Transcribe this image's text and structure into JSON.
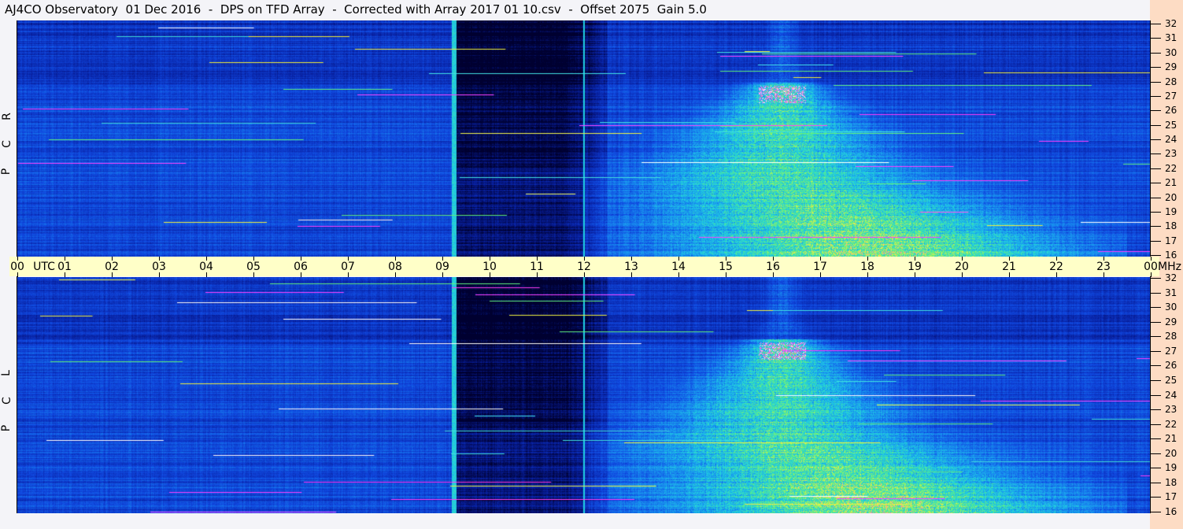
{
  "title": "AJ4CO Observatory  01 Dec 2016  -  DPS on TFD Array  -  Corrected with Array 2017 01 10.csv  -  Offset 2075  Gain 5.0",
  "chart_data": {
    "type": "heatmap",
    "panels": [
      {
        "label_letters": [
          "R",
          "C",
          "P"
        ]
      },
      {
        "label_letters": [
          "L",
          "C",
          "P"
        ]
      }
    ],
    "x_axis": {
      "unit_label": "UTC",
      "range_hours": [
        0,
        24
      ],
      "tick_labels": [
        "00",
        "01",
        "02",
        "03",
        "04",
        "05",
        "06",
        "07",
        "08",
        "09",
        "10",
        "11",
        "12",
        "13",
        "14",
        "15",
        "16",
        "17",
        "18",
        "19",
        "20",
        "21",
        "22",
        "23",
        "00"
      ]
    },
    "y_axis": {
      "unit_label": "MHz",
      "range": [
        16,
        32
      ],
      "tick_labels": [
        "32",
        "31",
        "30",
        "29",
        "28",
        "27",
        "26",
        "25",
        "24",
        "23",
        "22",
        "21",
        "20",
        "19",
        "18",
        "17",
        "16"
      ]
    },
    "colormap": [
      "#000030",
      "#0820a0",
      "#1048e0",
      "#1890f0",
      "#20d0e0",
      "#60f080",
      "#f0f040",
      "#ff40ff",
      "#ffffff"
    ],
    "features": {
      "vertical_bright_line_utc": 9.25,
      "dark_interval_utc": [
        9.3,
        12.5
      ],
      "emission_interval_utc": [
        12.0,
        23.5
      ],
      "emission_peak_utc": 16.2,
      "emission_peak_mhz": 27
    }
  }
}
